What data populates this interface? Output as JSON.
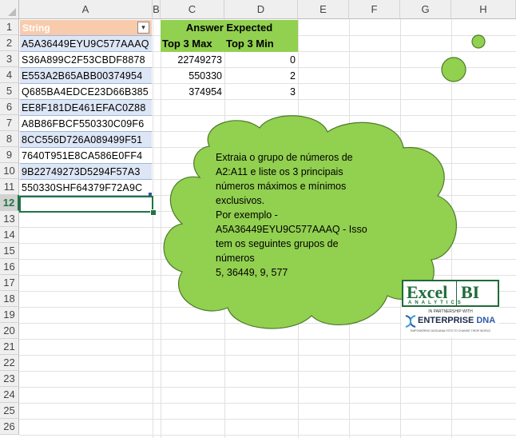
{
  "columns": [
    "A",
    "B",
    "C",
    "D",
    "E",
    "F",
    "G",
    "H"
  ],
  "rows": [
    "1",
    "2",
    "3",
    "4",
    "5",
    "6",
    "7",
    "8",
    "9",
    "10",
    "11",
    "12",
    "13",
    "14",
    "15",
    "16",
    "17",
    "18",
    "19",
    "20",
    "21",
    "22",
    "23",
    "24",
    "25",
    "26"
  ],
  "table_header": "String",
  "strings": [
    "A5A36449EYU9C577AAAQ",
    "S36A899C2F53CBDF8878",
    "E553A2B65ABB00374954",
    "Q685BA4EDCE23D66B385",
    "EE8F181DE461EFAC0Z88",
    "A8B86FBCF550330C09F6",
    "8CC556D726A089499F51",
    "7640T951E8CA586E0FF4",
    "9B22749273D5294F57A3",
    "550330SHF64379F72A9C"
  ],
  "answer": {
    "title": "Answer Expected",
    "max_header": "Top 3 Max",
    "min_header": "Top 3 Min",
    "max_values": [
      "22749273",
      "550330",
      "374954"
    ],
    "min_values": [
      "0",
      "2",
      "3"
    ]
  },
  "callout": {
    "lines": [
      "Extraia o grupo de números de",
      "A2:A11 e liste os 3 principais",
      "números máximos e mínimos",
      "exclusivos.",
      "Por exemplo -",
      "A5A36449EYU9C577AAAQ - Isso",
      "tem os seguintes grupos de",
      "números",
      "5, 36449, 9, 577"
    ]
  },
  "logo": {
    "brand_left": "Excel",
    "brand_right": "BI",
    "brand_sub": "ANALYTICS",
    "partnership": "IN PARTNERSHIP WITH",
    "partner": "ENTERPRISE",
    "partner_suffix": "DNA",
    "tagline": "EMPOWERING DATA ANALYSTS TO CHANGE THEIR WORLD"
  },
  "colors": {
    "green": "#92d050",
    "header_fill": "#f8cbad",
    "band_fill": "#dde6f4",
    "selection": "#217346"
  }
}
